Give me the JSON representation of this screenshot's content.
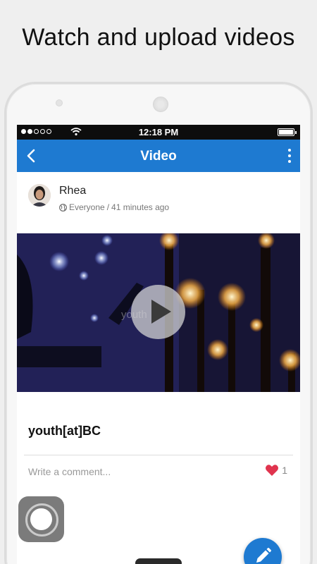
{
  "headline": "Watch and upload videos",
  "statusbar": {
    "time": "12:18 PM",
    "signal_bars": 2
  },
  "appbar": {
    "title": "Video",
    "back_icon": "chevron-left-icon",
    "menu_icon": "more-vertical-icon",
    "color": "#1e7ad1"
  },
  "post": {
    "author": "Rhea",
    "audience": "Everyone",
    "separator": "/",
    "time_ago": "41 minutes ago",
    "video_watermark": "youth",
    "title": "youth[at]BC"
  },
  "comment": {
    "placeholder": "Write a comment...",
    "like_count": "1",
    "heart_color": "#e0344e"
  },
  "fab": {
    "icon": "pencil-icon"
  },
  "assistive_touch": {
    "icon": "assistive-touch-icon"
  }
}
